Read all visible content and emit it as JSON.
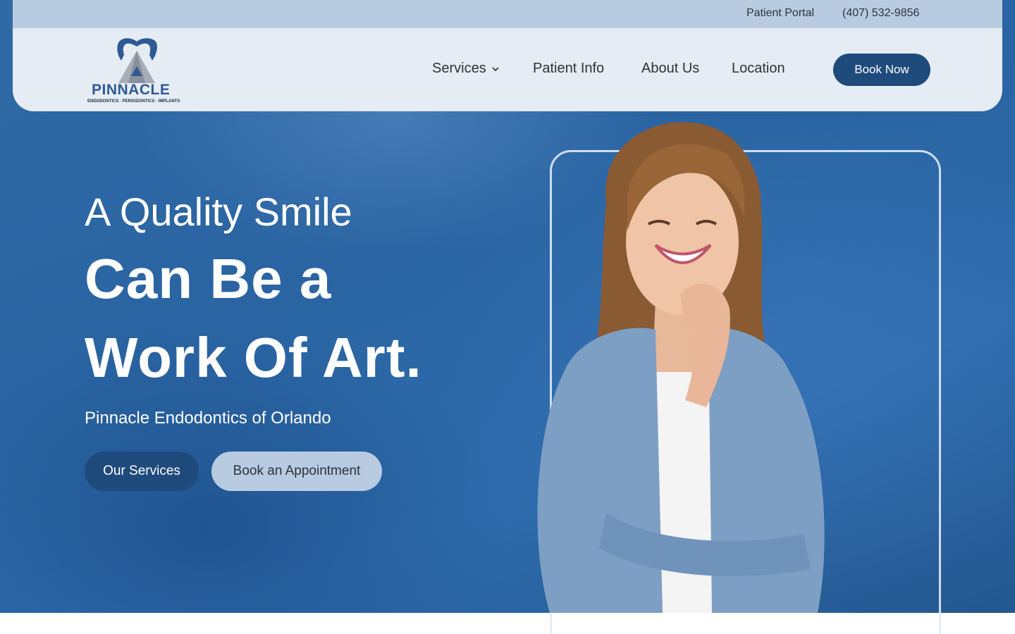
{
  "topbar": {
    "patient_portal": "Patient Portal",
    "phone": "(407) 532-9856"
  },
  "logo": {
    "name": "PINNACLE",
    "tagline": "ENDODONTICS · PERIODONTICS · IMPLANTS"
  },
  "nav": {
    "items": [
      {
        "label": "Services",
        "has_dropdown": true
      },
      {
        "label": "Patient Info"
      },
      {
        "label": "About Us"
      },
      {
        "label": "Location"
      }
    ],
    "book_now": "Book Now"
  },
  "hero": {
    "headline_light": "A Quality Smile",
    "headline_bold_1": "Can Be a",
    "headline_bold_2": "Work Of Art.",
    "subtitle": "Pinnacle Endodontics of Orlando",
    "primary_button": "Our Services",
    "secondary_button": "Book an Appointment"
  },
  "colors": {
    "brand_dark_blue": "#1f4a7c",
    "light_blue": "#b9cbe0",
    "hero_blue": "#2e6cad",
    "nav_bg": "#e6ecf4"
  },
  "icons": {
    "logo": "tooth-mountain-logo",
    "dropdown": "chevron-down-icon"
  }
}
